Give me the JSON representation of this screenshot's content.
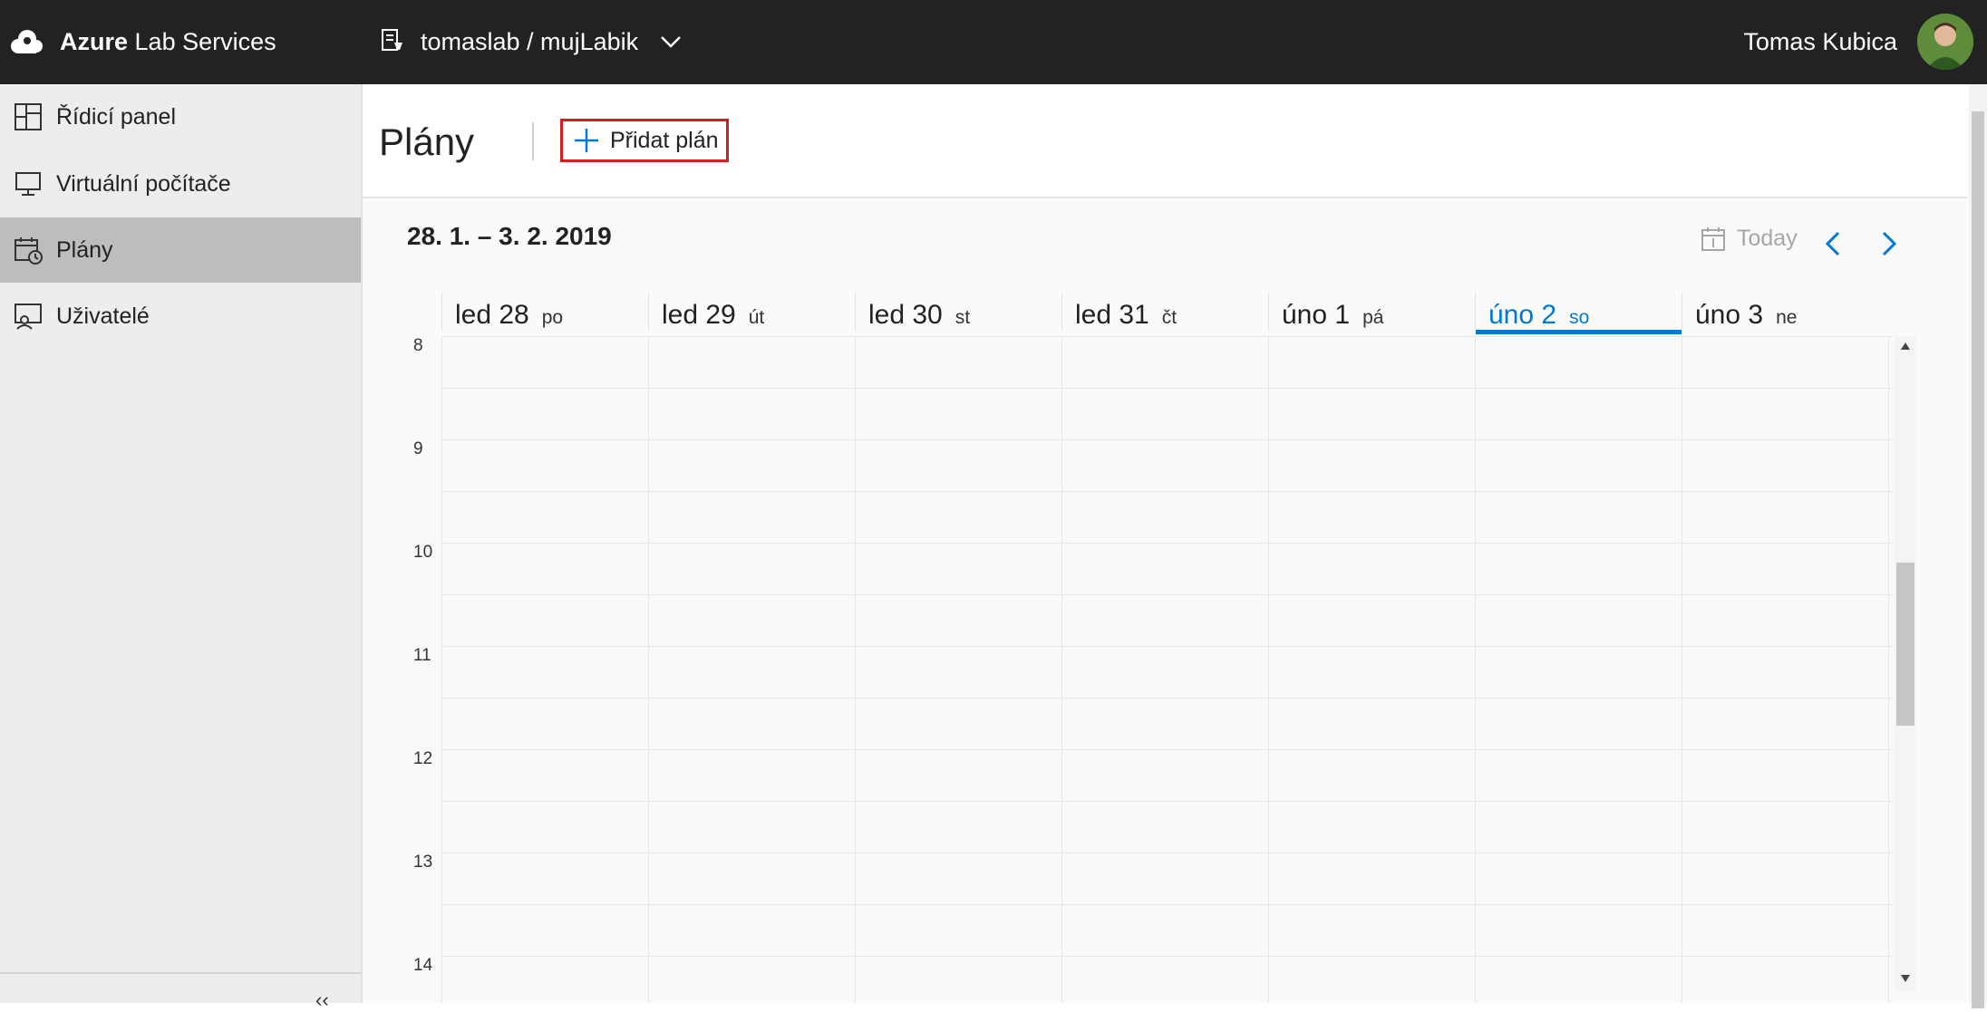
{
  "app": {
    "brand_bold": "Azure",
    "brand_rest": "Lab Services"
  },
  "lab_selector": {
    "label": "tomaslab / mujLabik"
  },
  "user": {
    "name": "Tomas Kubica"
  },
  "sidebar": {
    "items": [
      {
        "label": "Řídicí panel",
        "icon": "dashboard-icon",
        "active": false
      },
      {
        "label": "Virtuální počítače",
        "icon": "monitor-icon",
        "active": false
      },
      {
        "label": "Plány",
        "icon": "schedule-calendar-icon",
        "active": true
      },
      {
        "label": "Uživatelé",
        "icon": "users-icon",
        "active": false
      }
    ],
    "collapse_label": "‹‹"
  },
  "page": {
    "title": "Plány",
    "add_button_label": "Přidat plán"
  },
  "calendar": {
    "range_label": "28. 1. – 3. 2. 2019",
    "today_label": "Today",
    "days": [
      {
        "date": "led 28",
        "weekday": "po",
        "current": false
      },
      {
        "date": "led 29",
        "weekday": "út",
        "current": false
      },
      {
        "date": "led 30",
        "weekday": "st",
        "current": false
      },
      {
        "date": "led 31",
        "weekday": "čt",
        "current": false
      },
      {
        "date": "úno 1",
        "weekday": "pá",
        "current": false
      },
      {
        "date": "úno 2",
        "weekday": "so",
        "current": true
      },
      {
        "date": "úno 3",
        "weekday": "ne",
        "current": false
      }
    ],
    "hours": [
      "8",
      "9",
      "10",
      "11",
      "12",
      "13",
      "14"
    ],
    "accent_color": "#0078d4"
  },
  "colors": {
    "topbar": "#222222",
    "highlight_border": "#d02020"
  }
}
